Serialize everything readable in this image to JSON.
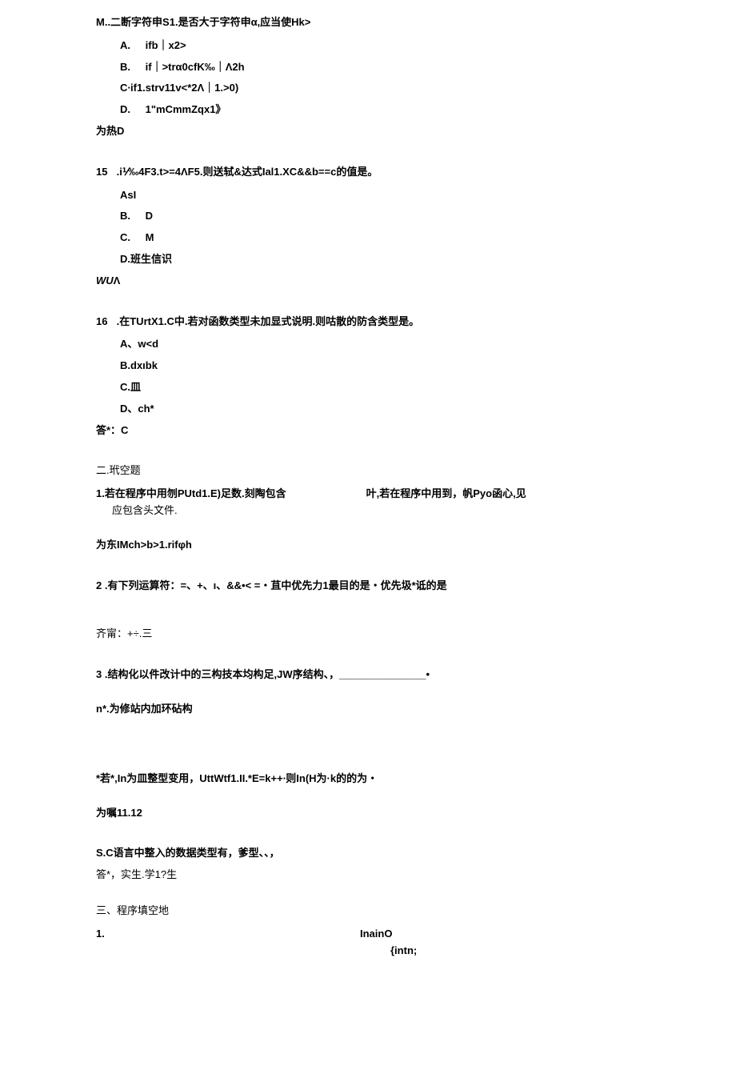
{
  "q14": {
    "stem": "M..二断字符申S1.是否大于字符申α,应当使Hk>",
    "opts": {
      "A_letter": "A.",
      "A_text": "ifb｜x2>",
      "B_letter": "B.",
      "B_text": "if｜>trα0cfK‰｜Λ2h",
      "C_text": "C∙if1.strv11v<*2Λ｜1.>0)",
      "D_letter": "D.",
      "D_text": "1\"mCmmZqx1》"
    },
    "answer": "为热D"
  },
  "q15": {
    "num": "15",
    "stem": ".i⅟‰4F3.t>=4ΛF5.则送轼&达式Ial1.XC&&b==c的值是。",
    "opts": {
      "A": "AsI",
      "B_letter": "B.",
      "B_text": "D",
      "C_letter": "C.",
      "C_text": "M",
      "D": "D.班生信识"
    },
    "answer_italic": "WU",
    "answer_tail": "Λ"
  },
  "q16": {
    "num": "16",
    "stem": ".在TUrtX1.C中.若对函数类型未加显式说明.则咕散的防含类型是。",
    "opts": {
      "A": "A、w<d",
      "B": "B.dxıbk",
      "C": "C.皿",
      "D": "D、ch*"
    },
    "answer": "答*：C"
  },
  "section2_title": "二.玳空题",
  "f1": {
    "num": "1.",
    "left": "若在程序中用刎PUtd1.E)足数.刻陶包含",
    "right": "叶,若在程序中用到，帆Pyo函心,见",
    "line2": "应包含头文件.",
    "answer": "为东IMch>b>1.rifφh"
  },
  "f2": {
    "num": "2",
    "text": ".有下列运算符：=、+、ı、&&•< =・苴中优先力1最目的是・优先圾*诋的是",
    "answer": "齐甯：+÷.三"
  },
  "f3": {
    "num": "3",
    "text": ".结构化以件改计中的三构技本均构足,JW序结构、，_______________•",
    "answer": "n*.为修站内加环砧构"
  },
  "f4": {
    "text": "*若*,In为皿整型变用，UttWtf1.II.*E=k++∙则In(H为·k的的为・",
    "answer": "为嘱11.12"
  },
  "f5": {
    "text": "S.C语言中整入的数据类型有，爹型、、，",
    "answer": "答*，实生.学1?生"
  },
  "section3_title": "三、程序填空地",
  "p1": {
    "num": "1.",
    "inaino": "InainO",
    "intn": "{intn;"
  }
}
